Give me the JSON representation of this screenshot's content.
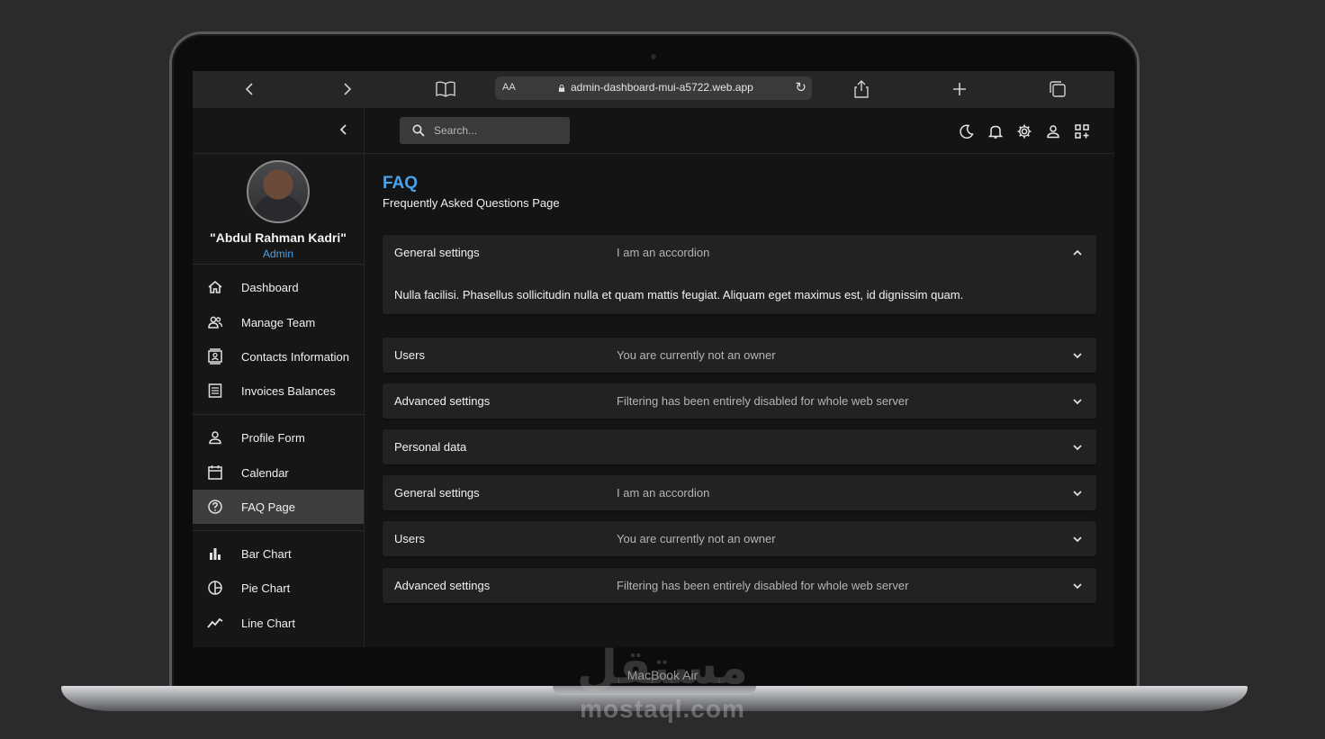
{
  "browser": {
    "text_size": "AA",
    "url": "admin-dashboard-mui-a5722.web.app"
  },
  "device": {
    "label": "MacBook Air",
    "watermark_ar": "مستقل",
    "watermark": "mostaql.com"
  },
  "sidebar": {
    "user_name": "\"Abdul Rahman Kadri\"",
    "user_role": "Admin",
    "items": [
      {
        "label": "Dashboard",
        "icon": "home-icon"
      },
      {
        "label": "Manage Team",
        "icon": "people-icon"
      },
      {
        "label": "Contacts Information",
        "icon": "contacts-icon"
      },
      {
        "label": "Invoices Balances",
        "icon": "receipt-icon"
      },
      {
        "label": "Profile Form",
        "icon": "person-icon"
      },
      {
        "label": "Calendar",
        "icon": "calendar-icon"
      },
      {
        "label": "FAQ Page",
        "icon": "help-icon",
        "active": true
      },
      {
        "label": "Bar Chart",
        "icon": "bar-chart-icon"
      },
      {
        "label": "Pie Chart",
        "icon": "pie-chart-icon"
      },
      {
        "label": "Line Chart",
        "icon": "line-chart-icon"
      }
    ]
  },
  "topbar": {
    "search_placeholder": "Search..."
  },
  "page": {
    "title": "FAQ",
    "subtitle": "Frequently Asked Questions Page"
  },
  "accordions": [
    {
      "title": "General settings",
      "subtitle": "I am an accordion",
      "expanded": true,
      "body": "Nulla facilisi. Phasellus sollicitudin nulla et quam mattis feugiat. Aliquam eget maximus est, id dignissim quam."
    },
    {
      "title": "Users",
      "subtitle": "You are currently not an owner",
      "expanded": false
    },
    {
      "title": "Advanced settings",
      "subtitle": "Filtering has been entirely disabled for whole web server",
      "expanded": false
    },
    {
      "title": "Personal data",
      "subtitle": "",
      "expanded": false
    },
    {
      "title": "General settings",
      "subtitle": "I am an accordion",
      "expanded": false
    },
    {
      "title": "Users",
      "subtitle": "You are currently not an owner",
      "expanded": false
    },
    {
      "title": "Advanced settings",
      "subtitle": "Filtering has been entirely disabled for whole web server",
      "expanded": false
    }
  ],
  "colors": {
    "accent": "#4aa3ea",
    "background": "#141414",
    "panel": "#222222",
    "active_nav": "#3d3d3d"
  }
}
